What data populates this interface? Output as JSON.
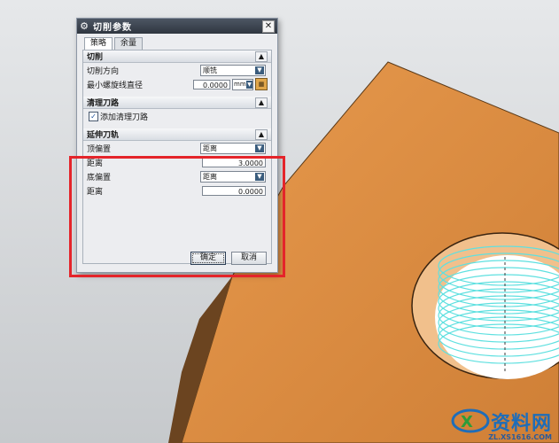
{
  "dialog": {
    "title": "切削参数",
    "tabs": [
      "策略",
      "余量"
    ],
    "sections": {
      "cutting": {
        "header": "切削",
        "direction_label": "切削方向",
        "direction_value": "顺铣",
        "min_diameter_label": "最小螺旋线直径",
        "min_diameter_value": "0.0000",
        "min_diameter_unit": "mm"
      },
      "cleanup": {
        "header": "清理刀路",
        "add_cleanup_label": "添加清理刀路",
        "add_cleanup_checked": true
      },
      "extend": {
        "header": "延伸刀轨",
        "top_offset_label": "顶偏置",
        "top_offset_value": "距离",
        "top_distance_label": "距离",
        "top_distance_value": "3.0000",
        "bottom_offset_label": "底偏置",
        "bottom_offset_value": "距离",
        "bottom_distance_label": "距离",
        "bottom_distance_value": "0.0000"
      }
    },
    "buttons": {
      "ok": "确定",
      "cancel": "取消"
    }
  },
  "watermark": {
    "brand": "资料网",
    "url": "ZL.XS1616.COM"
  },
  "colors": {
    "highlight": "#e4242a",
    "part": "#d4873e",
    "toolpath": "#5fe0e0"
  }
}
